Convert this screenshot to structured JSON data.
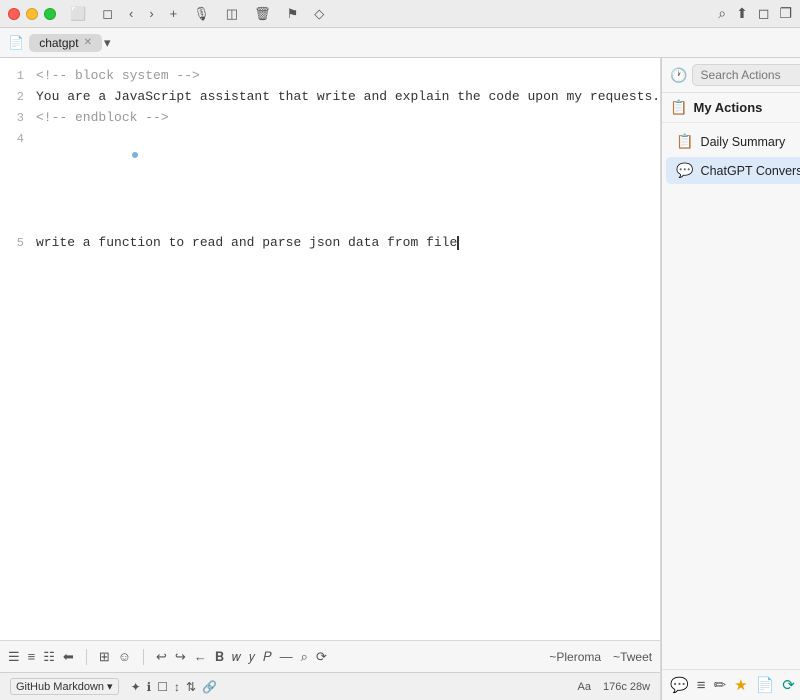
{
  "titlebar": {
    "controls": [
      "◀",
      "▶",
      "+",
      "⎙",
      "⊟",
      "✦",
      "☆"
    ],
    "right_icons": [
      "🔍",
      "⬆",
      "◻",
      "❐"
    ]
  },
  "tabbar": {
    "tab_label": "chatgpt",
    "dropdown": "▾"
  },
  "editor": {
    "lines": [
      {
        "num": "1",
        "text": "<!-- block system -->",
        "type": "comment"
      },
      {
        "num": "2",
        "text": "You are a JavaScript assistant that write and explain the code upon my requests.",
        "type": "normal"
      },
      {
        "num": "3",
        "text": "<!-- endblock -->",
        "type": "comment"
      },
      {
        "num": "4",
        "text": "",
        "type": "normal"
      },
      {
        "num": "5",
        "text": "write a function to read and parse json data from file",
        "type": "normal"
      }
    ]
  },
  "bottombar": {
    "icons": [
      "≡",
      "☰",
      "☷",
      "⬆",
      "⬛",
      "⁋",
      "☺",
      "↩",
      "↪",
      "←",
      "→",
      "𝐁",
      "𝑤",
      "𝑦",
      "𝑃",
      "—",
      "🔍",
      "⟳"
    ],
    "tilde_items": [
      "~Pleroma",
      "~Tweet"
    ]
  },
  "statusbar": {
    "mode": "GitHub Markdown",
    "icons": [
      "✦",
      "ℹ",
      "☐",
      "⬆⬇",
      "↕",
      "🔗"
    ],
    "right": [
      "Aa",
      "176c 28w"
    ]
  },
  "actions_panel": {
    "search_placeholder": "Search Actions",
    "title": "My Actions",
    "items": [
      {
        "label": "Daily Summary",
        "icon_type": "daily",
        "active": false
      },
      {
        "label": "ChatGPT Conversation",
        "icon_type": "chatgpt",
        "active": true
      }
    ],
    "bottom_icons": [
      "speech",
      "bars",
      "pencil",
      "star",
      "doc",
      "refresh"
    ]
  }
}
